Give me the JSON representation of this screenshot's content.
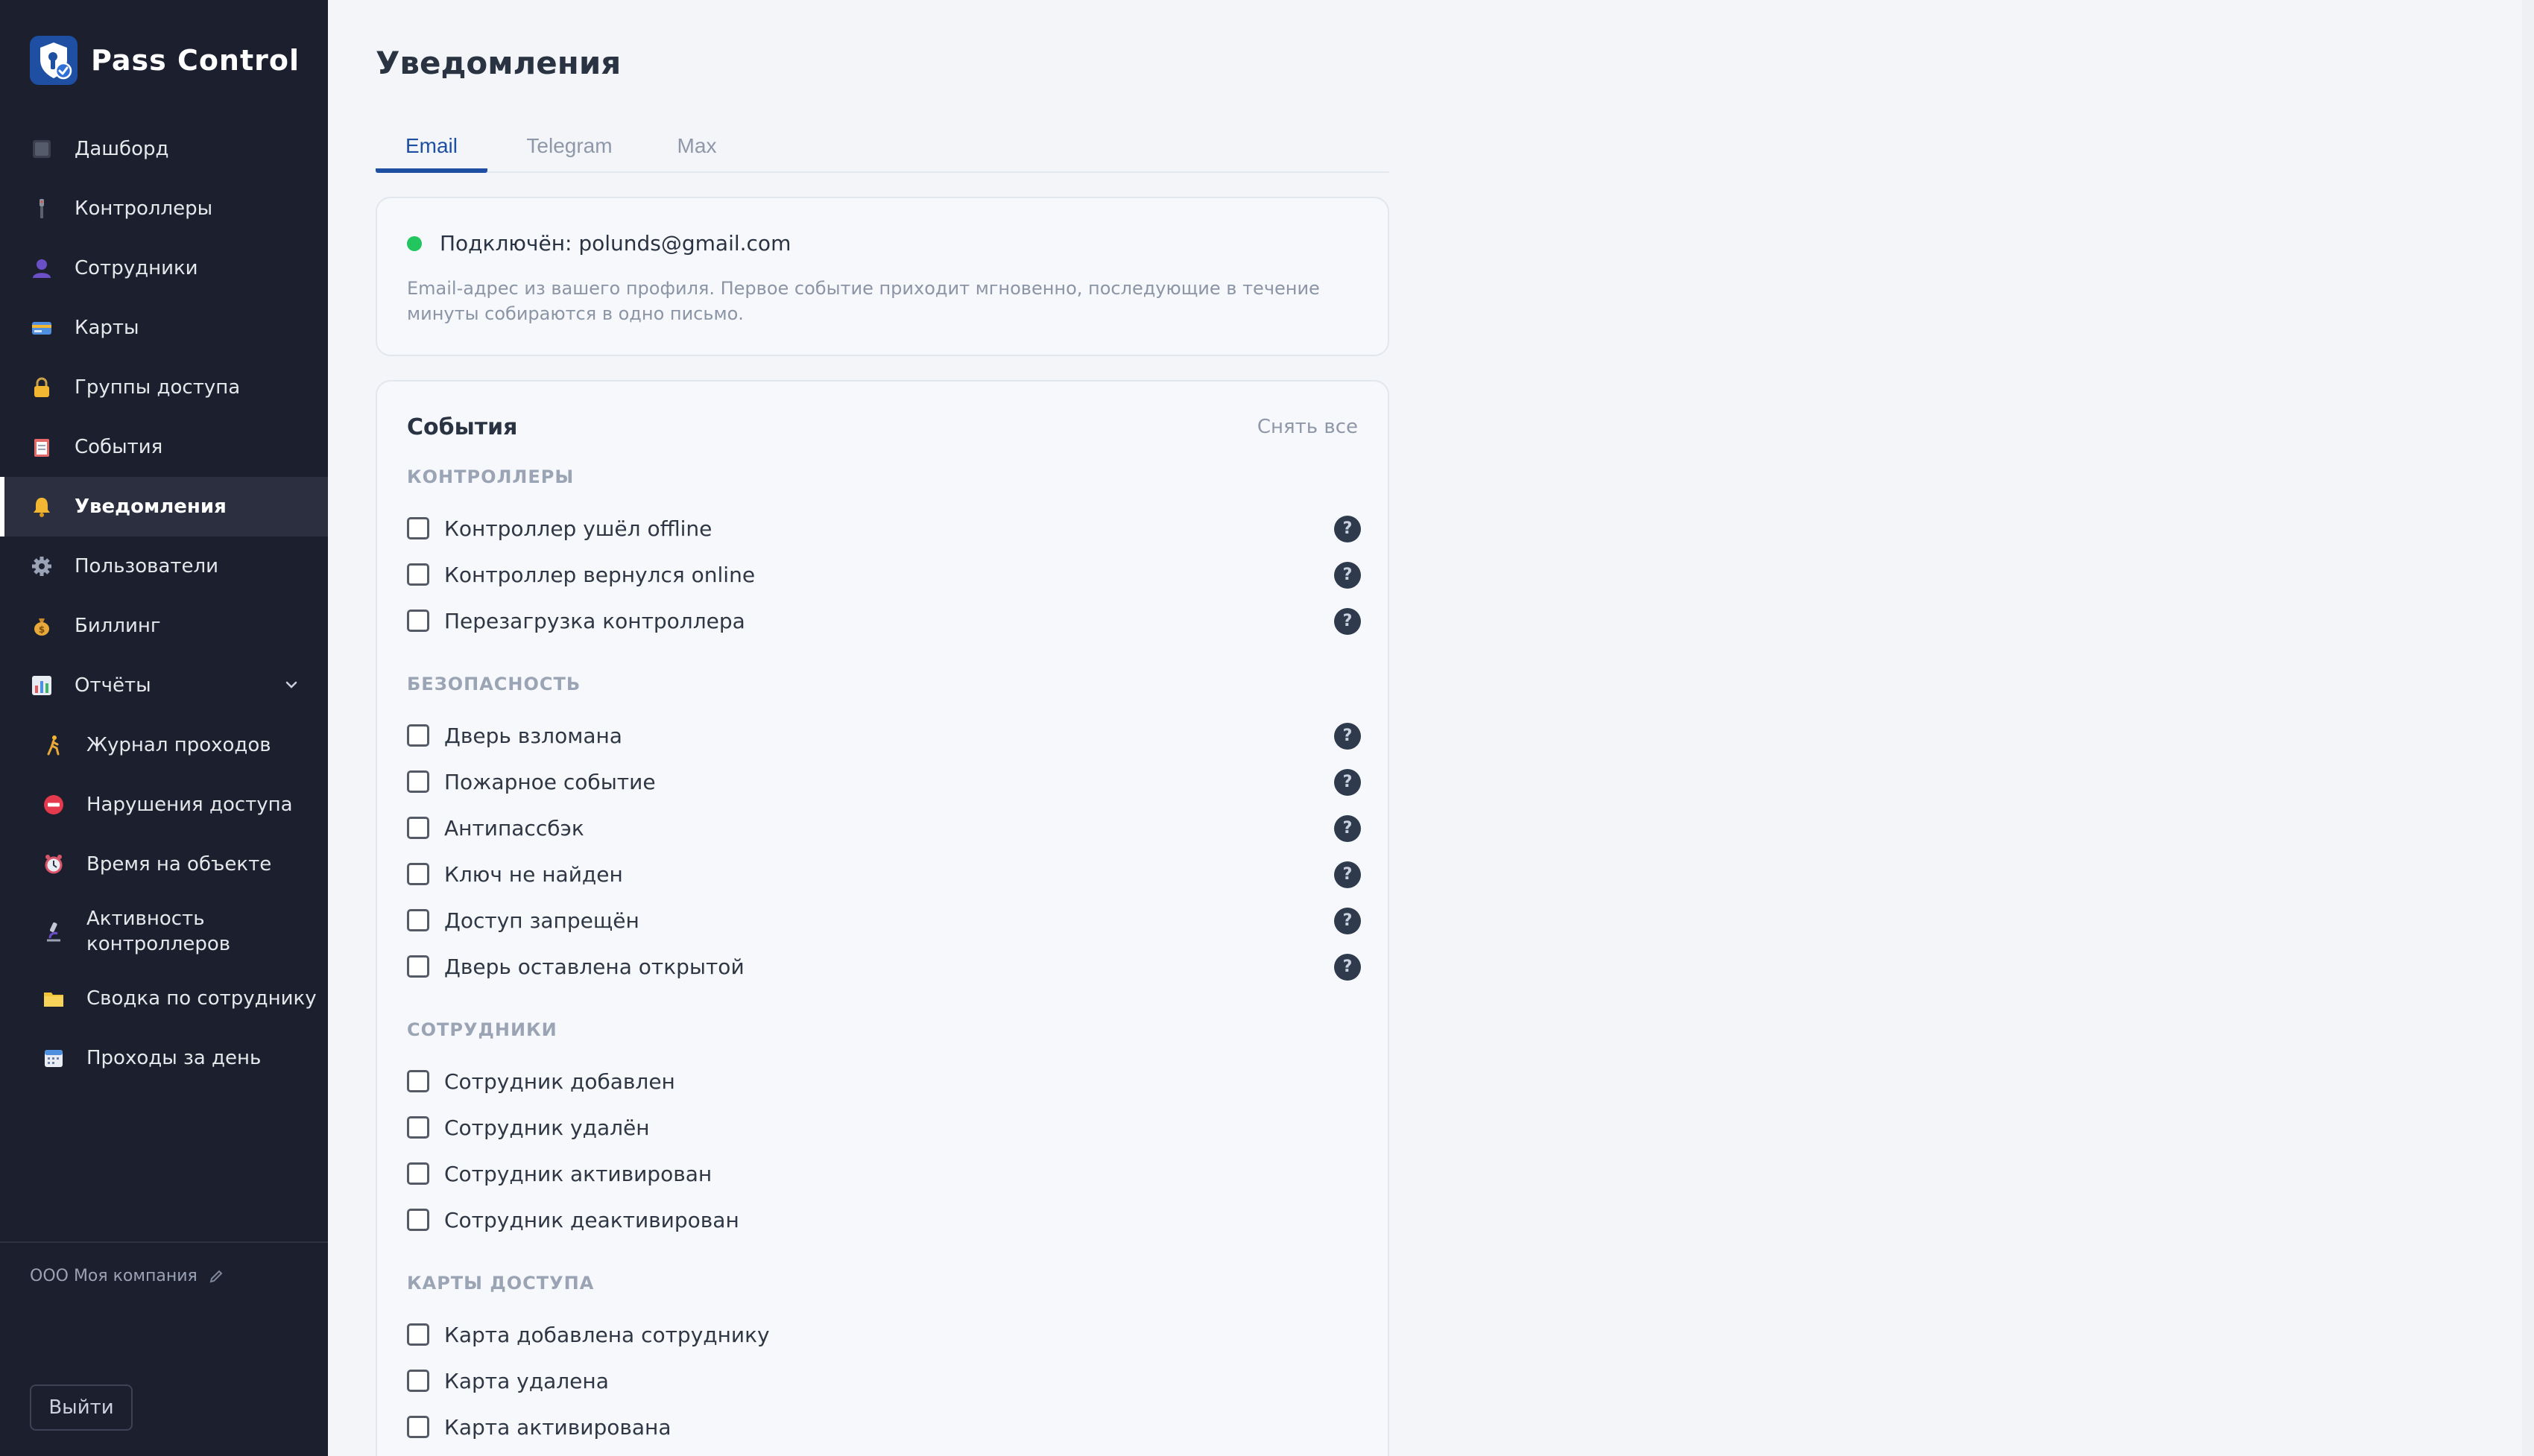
{
  "app": {
    "name": "Pass Control"
  },
  "sidebar": {
    "items": [
      {
        "label": "Дашборд",
        "icon": "dashboard-icon"
      },
      {
        "label": "Контроллеры",
        "icon": "controller-icon"
      },
      {
        "label": "Сотрудники",
        "icon": "user-icon"
      },
      {
        "label": "Карты",
        "icon": "card-icon"
      },
      {
        "label": "Группы доступа",
        "icon": "lock-icon"
      },
      {
        "label": "События",
        "icon": "clipboard-icon"
      },
      {
        "label": "Уведомления",
        "icon": "bell-icon",
        "active": true
      },
      {
        "label": "Пользователи",
        "icon": "gear-icon"
      },
      {
        "label": "Биллинг",
        "icon": "money-bag-icon"
      },
      {
        "label": "Отчёты",
        "icon": "bar-chart-icon",
        "expanded": true
      }
    ],
    "reports": [
      {
        "label": "Журнал проходов",
        "icon": "walking-icon"
      },
      {
        "label": "Нарушения доступа",
        "icon": "no-entry-icon"
      },
      {
        "label": "Время на объекте",
        "icon": "alarm-clock-icon"
      },
      {
        "label": "Активность контроллеров",
        "icon": "microscope-icon"
      },
      {
        "label": "Сводка по сотруднику",
        "icon": "folder-icon"
      },
      {
        "label": "Проходы за день",
        "icon": "calendar-icon"
      }
    ],
    "company": "ООО Моя компания",
    "logout_label": "Выйти"
  },
  "main": {
    "title": "Уведомления",
    "tabs": [
      {
        "label": "Email",
        "active": true
      },
      {
        "label": "Telegram"
      },
      {
        "label": "Max"
      }
    ],
    "status": {
      "text": "Подключён: polunds@gmail.com",
      "description": "Email-адрес из вашего профиля. Первое событие приходит мгновенно, последующие в течение минуты собираются в одно письмо."
    },
    "events": {
      "title": "События",
      "clear_all": "Снять все",
      "sections": [
        {
          "heading": "КОНТРОЛЛЕРЫ",
          "items": [
            {
              "label": "Контроллер ушёл offline",
              "checked": false,
              "help": "?"
            },
            {
              "label": "Контроллер вернулся online",
              "checked": false,
              "help": "?"
            },
            {
              "label": "Перезагрузка контроллера",
              "checked": false,
              "help": "?"
            }
          ]
        },
        {
          "heading": "БЕЗОПАСНОСТЬ",
          "items": [
            {
              "label": "Дверь взломана",
              "checked": false,
              "help": "?"
            },
            {
              "label": "Пожарное событие",
              "checked": false,
              "help": "?"
            },
            {
              "label": "Антипассбэк",
              "checked": false,
              "help": "?"
            },
            {
              "label": "Ключ не найден",
              "checked": false,
              "help": "?"
            },
            {
              "label": "Доступ запрещён",
              "checked": false,
              "help": "?"
            },
            {
              "label": "Дверь оставлена открытой",
              "checked": false,
              "help": "?"
            }
          ]
        },
        {
          "heading": "СОТРУДНИКИ",
          "items": [
            {
              "label": "Сотрудник добавлен",
              "checked": false
            },
            {
              "label": "Сотрудник удалён",
              "checked": false
            },
            {
              "label": "Сотрудник активирован",
              "checked": false
            },
            {
              "label": "Сотрудник деактивирован",
              "checked": false
            }
          ]
        },
        {
          "heading": "КАРТЫ ДОСТУПА",
          "items": [
            {
              "label": "Карта добавлена сотруднику",
              "checked": false
            },
            {
              "label": "Карта удалена",
              "checked": false
            },
            {
              "label": "Карта активирована",
              "checked": false
            }
          ]
        }
      ]
    }
  },
  "colors": {
    "sidebar_bg": "#1c1f2e",
    "accent": "#1e4fa3",
    "status_connected": "#22c55e",
    "help_badge": "#2f3b4d"
  }
}
